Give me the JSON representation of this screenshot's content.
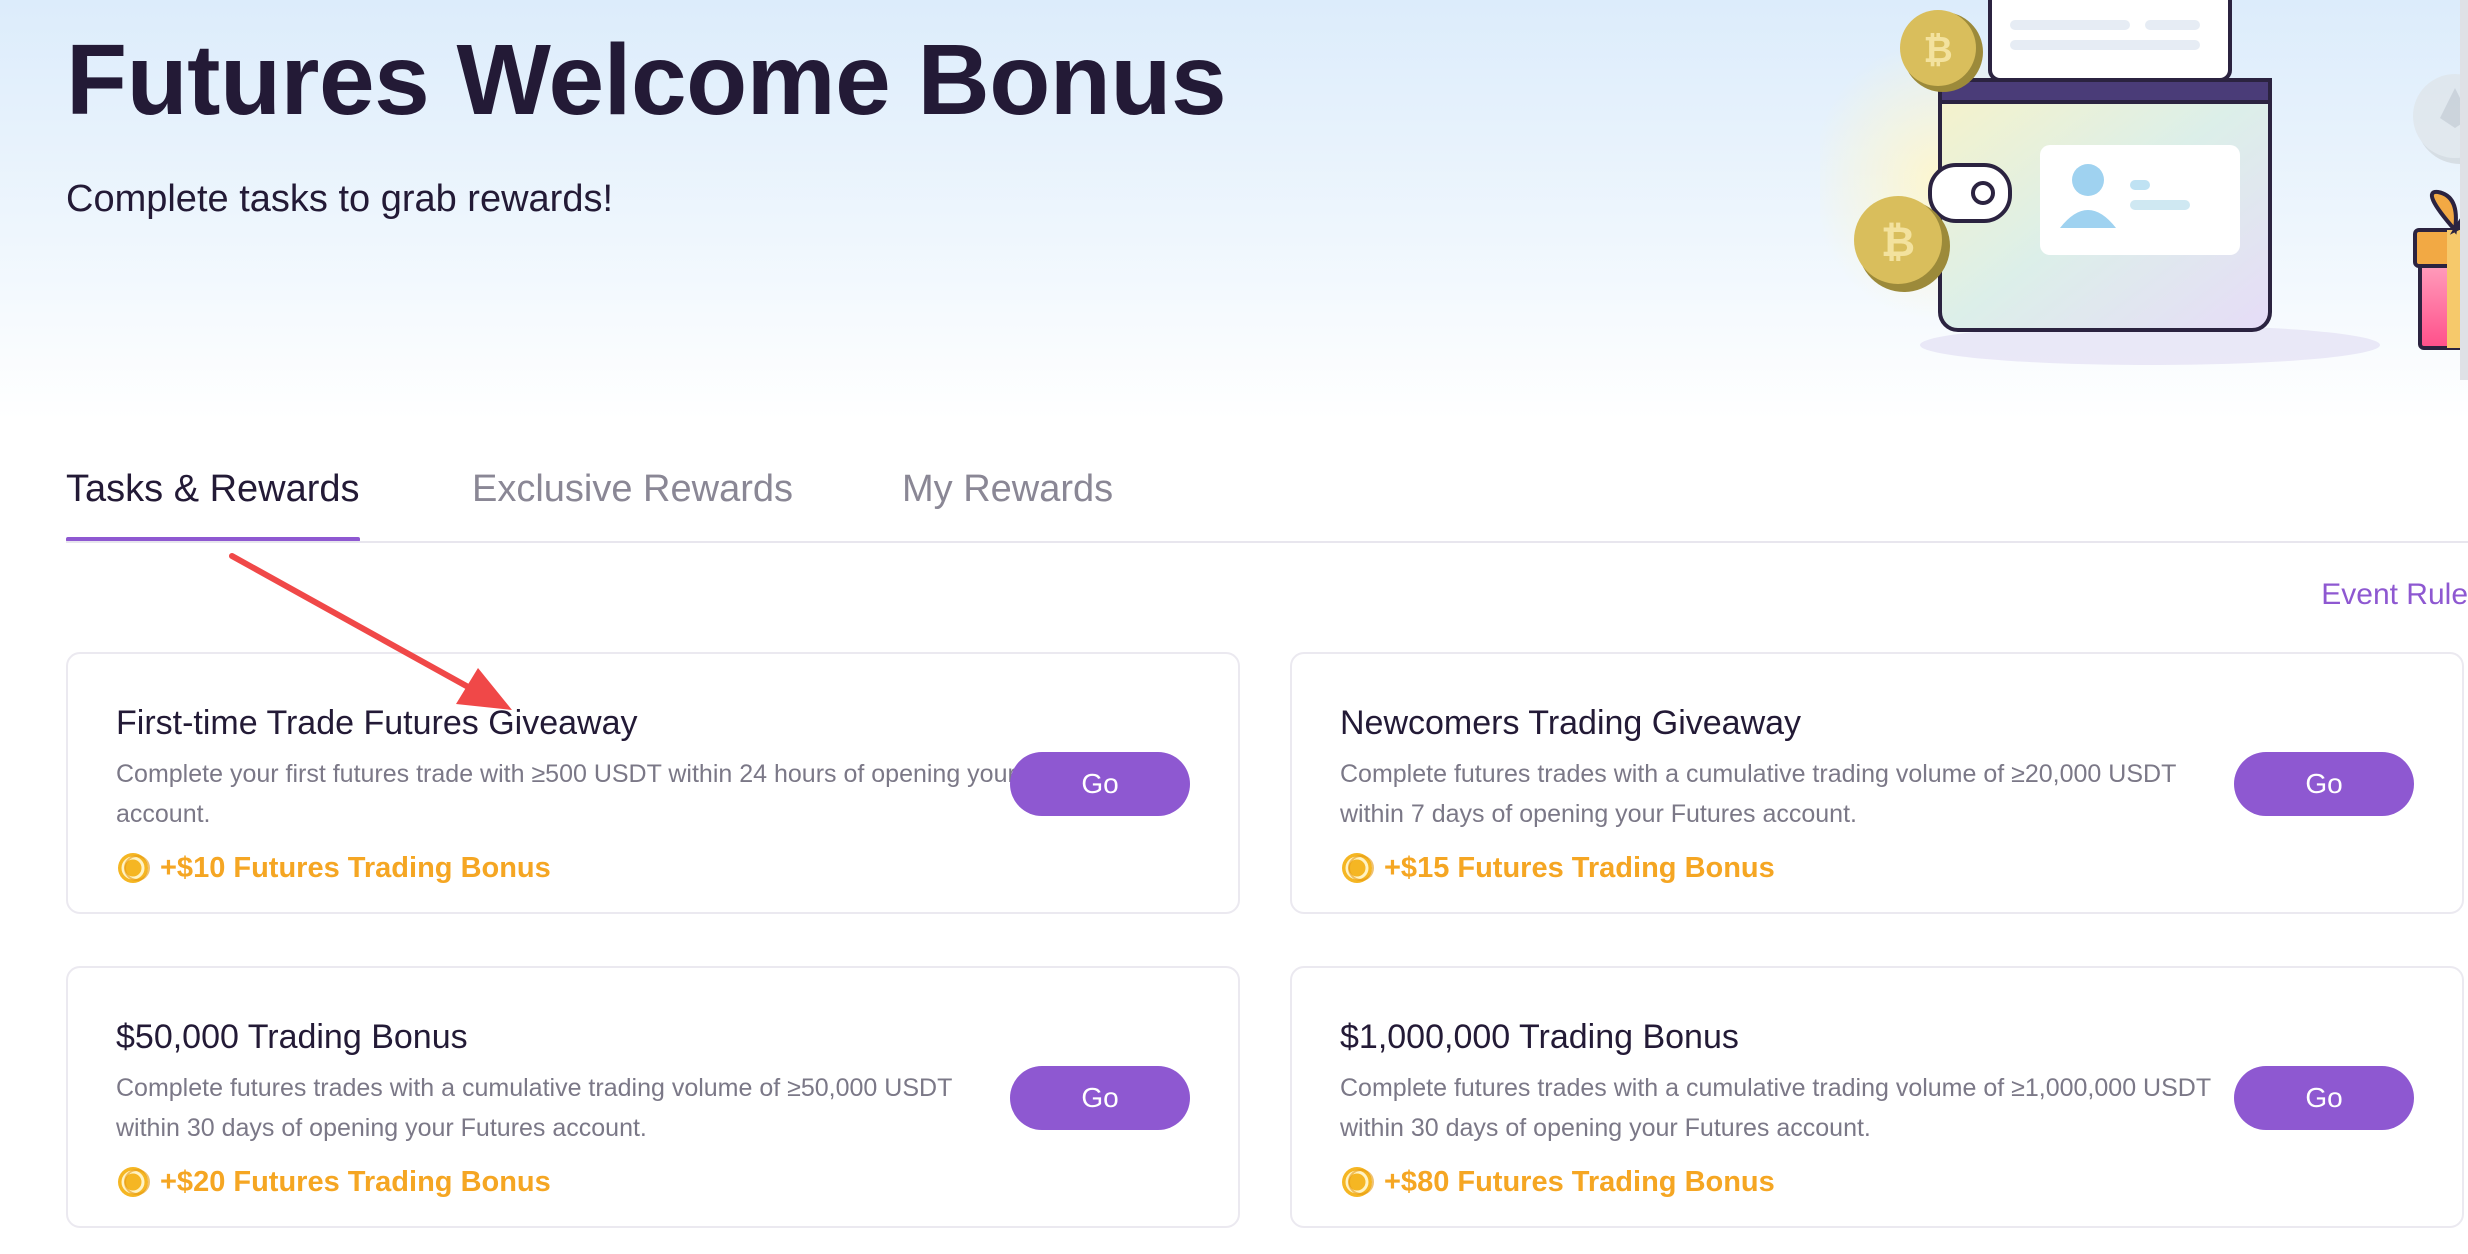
{
  "header": {
    "title": "Futures Welcome Bonus",
    "subtitle": "Complete tasks to grab rewards!"
  },
  "tabs": [
    {
      "label": "Tasks & Rewards",
      "active": true
    },
    {
      "label": "Exclusive Rewards",
      "active": false
    },
    {
      "label": "My Rewards",
      "active": false
    }
  ],
  "event_rule_label": "Event Rule",
  "tasks": [
    {
      "title": "First-time Trade Futures Giveaway",
      "description": "Complete your first futures trade with ≥500 USDT within 24 hours of opening your Futures account.",
      "button_label": "Go",
      "reward": "+$10 Futures Trading Bonus"
    },
    {
      "title": "Newcomers Trading Giveaway",
      "description": "Complete futures trades with a cumulative trading volume of ≥20,000 USDT within 7 days of opening your Futures account.",
      "button_label": "Go",
      "reward": "+$15 Futures Trading Bonus"
    },
    {
      "title": "$50,000 Trading Bonus",
      "description": "Complete futures trades with a cumulative trading volume of ≥50,000 USDT within 30 days of opening your Futures account.",
      "button_label": "Go",
      "reward": "+$20 Futures Trading Bonus"
    },
    {
      "title": "$1,000,000 Trading Bonus",
      "description": "Complete futures trades with a cumulative trading volume of ≥1,000,000 USDT within 30 days of opening your Futures account.",
      "button_label": "Go",
      "reward": "+$80 Futures Trading Bonus"
    }
  ],
  "colors": {
    "accent": "#8e58d1",
    "reward": "#f5a623",
    "annotation_arrow": "#f04848"
  },
  "icons": {
    "reward": "coin-icon",
    "hero": "wallet-illustration",
    "annotation": "red-arrow-annotation"
  }
}
